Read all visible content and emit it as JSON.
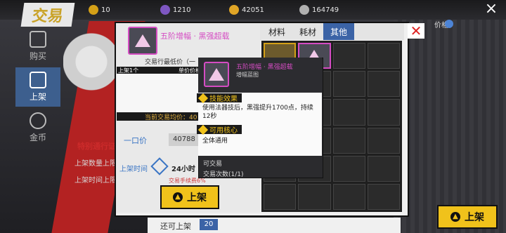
{
  "top_bar": {
    "resources": [
      {
        "icon": "coin-stack-icon",
        "value": "10",
        "color": "#d4a017"
      },
      {
        "icon": "purple-gem-icon",
        "value": "1210",
        "color": "#7e57c2"
      },
      {
        "icon": "gold-coin-icon",
        "value": "42051",
        "color": "#e0a526"
      },
      {
        "icon": "silver-coin-icon",
        "value": "164749",
        "color": "#b0b0b0"
      }
    ],
    "logo_text": "交易",
    "close_icon": "×"
  },
  "sidebar": {
    "items": [
      {
        "label": "购买",
        "icon": "tag-icon"
      },
      {
        "label": "上架",
        "icon": "gavel-icon"
      },
      {
        "label": "金币",
        "icon": "coin-icon"
      }
    ]
  },
  "left_info": {
    "title": "特别通行证",
    "line1": "上架数量上限",
    "line2": "上架时间上限"
  },
  "item_panel": {
    "name": "五阶增幅 · 黑强超载",
    "min_price_label": "交易行最低价（一",
    "qty_a": "上架1个",
    "qty_b": "单价价格",
    "avg_price": "当前交易均价：40",
    "one_price_label": "一口价",
    "one_price_value": "40788",
    "time_label": "上架时间",
    "time_value": "24小时",
    "fee_label": "交易手续费6%",
    "list_button": "上架"
  },
  "tabs": {
    "items": [
      "材料",
      "耗材",
      "其他"
    ],
    "active": 2
  },
  "rank_label": "价格",
  "tooltip": {
    "name": "五阶增幅 · 黑强超载",
    "subtitle": "增幅蓝图",
    "effect_title": "技能效果",
    "effect_text": "使用法器技后，黑强提升1700点，持续12秒",
    "core_title": "可用核心",
    "core_text": "全体通用",
    "tradeable": "可交易",
    "trade_count": "交易次数(1/1)"
  },
  "bottom": {
    "label": "还可上架",
    "count": "20",
    "right_button": "上架"
  },
  "colors": {
    "accent_blue": "#3b63a6",
    "accent_yellow": "#f0c21b",
    "rarity_pink": "#d54cc3",
    "danger_red": "#d22222"
  }
}
